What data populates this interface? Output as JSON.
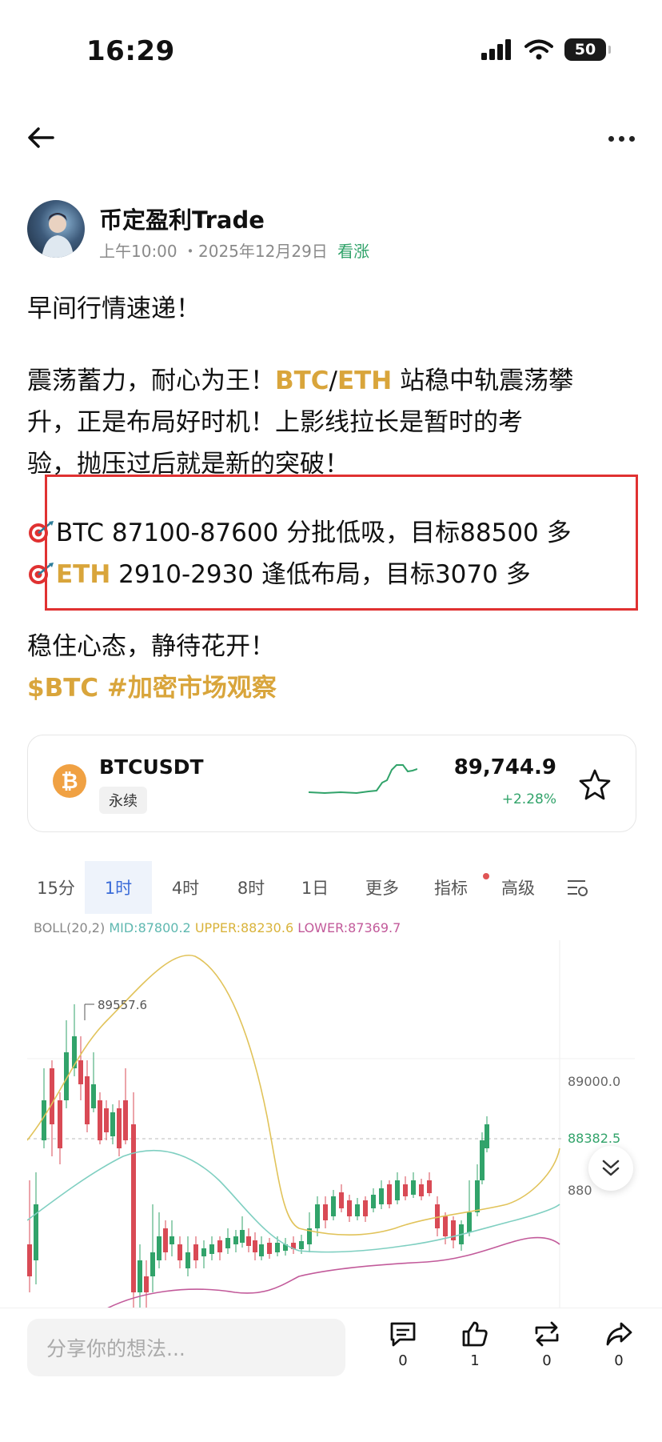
{
  "status_bar": {
    "time": "16:29",
    "battery": "50"
  },
  "post": {
    "author": "币定盈利Trade",
    "time": "上午10:00",
    "date": "・2025年12月29日",
    "sentiment": "看涨",
    "line1": "早间行情速递！",
    "p2_a": "震荡蓄力，耐心为王！",
    "p2_btc": "BTC",
    "p2_slash": "/",
    "p2_eth": "ETH",
    "p2_b": " 站稳中轨震荡攀",
    "p2_line2": "升，正是布局好时机！上影线拉长是暂时的考",
    "p2_line3": "验，抛压过后就是新的突破！",
    "btc_line": "BTC 87100-87600 分批低吸，目标88500 多",
    "eth_label": "ETH",
    "eth_line": " 2910-2930 逢低布局，目标3070 多",
    "closing": "稳住心态，静待花开！",
    "hashtags": "$BTC #加密市场观察"
  },
  "ticker": {
    "symbol": "BTCUSDT",
    "type": "永续",
    "price": "89,744.9",
    "change": "+2.28%"
  },
  "chart_tabs": [
    "15分",
    "1时",
    "4时",
    "8时",
    "1日",
    "更多",
    "指标",
    "高级"
  ],
  "boll": {
    "label": "BOLL(20,2)",
    "mid": "MID:87800.2",
    "upper": "UPPER:88230.6",
    "lower": "LOWER:87369.7"
  },
  "chart_labels": {
    "high": "89557.6",
    "level_89000": "89000.0",
    "current": "88382.5",
    "partial": "880"
  },
  "colors": {
    "up": "#31a36a",
    "down": "#d94a55",
    "upper": "#e1c35a",
    "mid": "#7fcfc1",
    "lower": "#c25a9a",
    "accent": "#d9a53b"
  },
  "bottom": {
    "placeholder": "分享你的想法...",
    "comments": "0",
    "likes": "1",
    "reposts": "0",
    "shares": "0"
  }
}
